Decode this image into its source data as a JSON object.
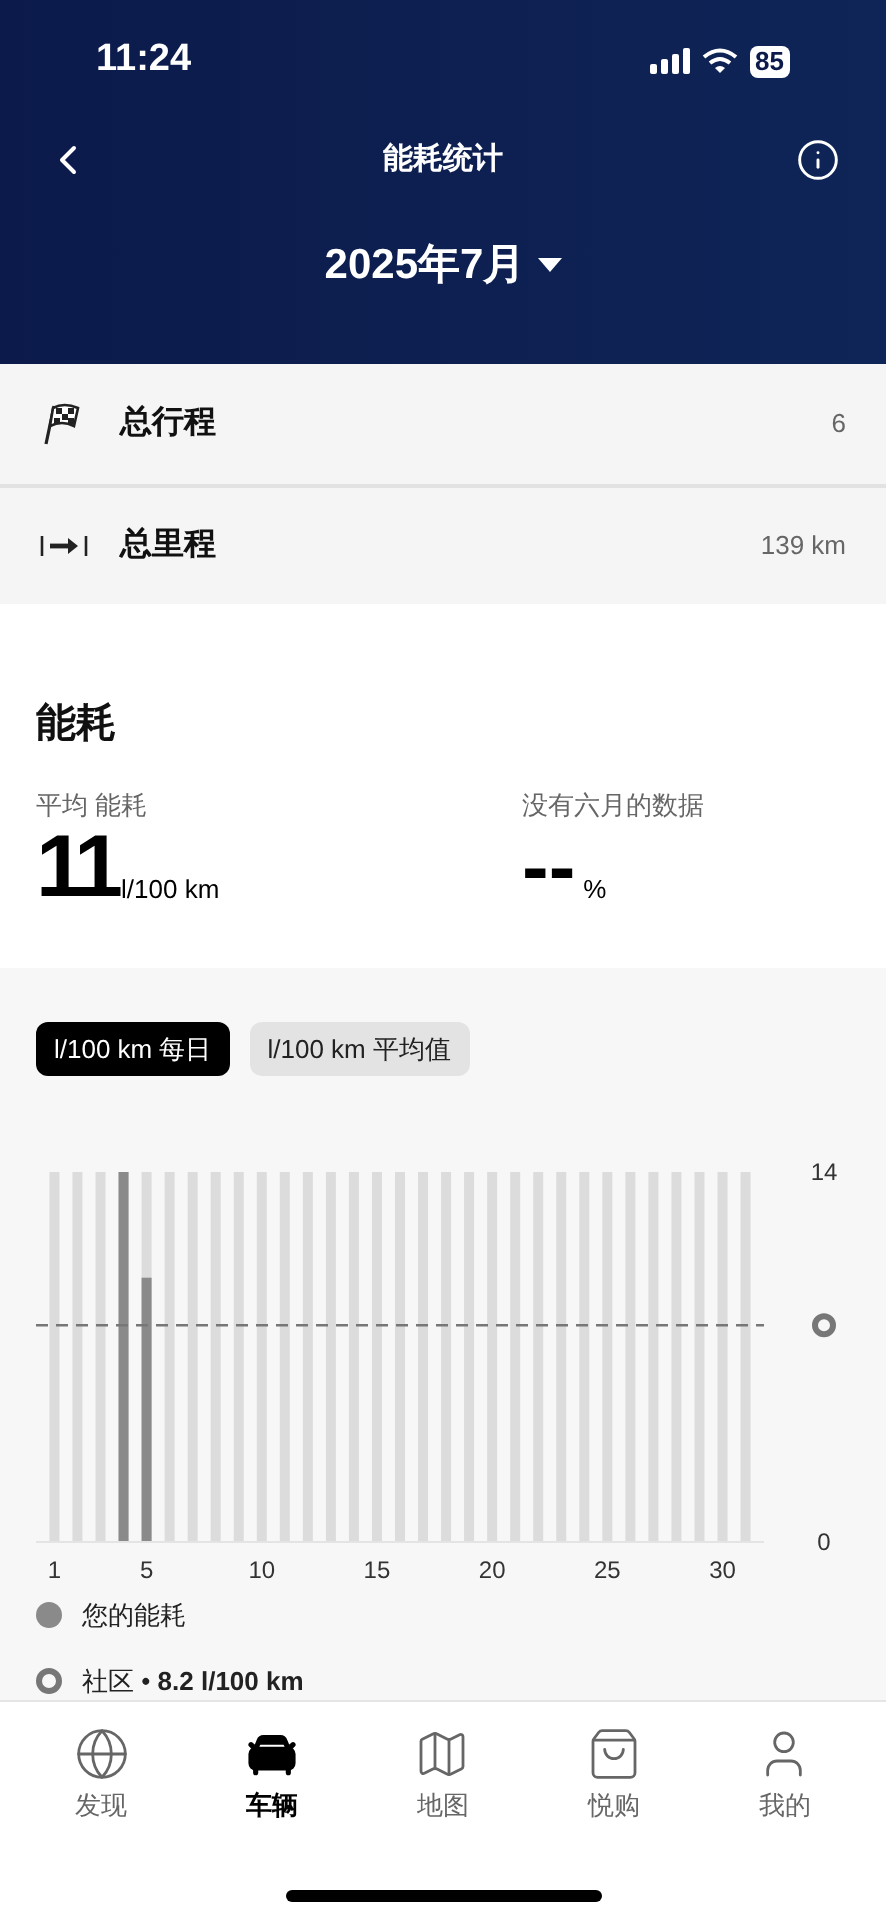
{
  "status_bar": {
    "time": "11:24",
    "battery": "85"
  },
  "header": {
    "title": "能耗统计",
    "period": "2025年7月"
  },
  "summary": [
    {
      "kind": "trips",
      "label": "总行程",
      "value": "6"
    },
    {
      "kind": "distance",
      "label": "总里程",
      "value": "139 km"
    }
  ],
  "consumption": {
    "title": "能耗",
    "average_label": "平均 能耗",
    "average_value": "11",
    "average_unit": "l/100 km",
    "compare_label": "没有六月的数据",
    "compare_value": "--",
    "compare_unit": "%"
  },
  "chart_tabs": [
    {
      "label": "l/100 km 每日",
      "selected": true
    },
    {
      "label": "l/100 km 平均值",
      "selected": false
    }
  ],
  "chart_data": {
    "type": "bar",
    "x": [
      4,
      5
    ],
    "series": [
      {
        "name": "您的能耗",
        "color": "#8a8a8a",
        "values": [
          14,
          10
        ]
      }
    ],
    "ylim": [
      0,
      14
    ],
    "yticks": [
      0,
      14
    ],
    "xticks": [
      1,
      5,
      10,
      15,
      20,
      25,
      30
    ],
    "xlim": [
      0.2,
      31.8
    ],
    "grid": true,
    "ref_lines": [
      {
        "axis": "y",
        "value": 8.2
      }
    ]
  },
  "legend": [
    {
      "kind": "ring",
      "label": "社区 • **8.2 l/100 km**"
    }
  ],
  "tab_bar": [
    {
      "kind": "globe",
      "label": "发现",
      "selected": false
    },
    {
      "kind": "car",
      "label": "车辆",
      "selected": true
    },
    {
      "kind": "map",
      "label": "地图",
      "selected": false
    },
    {
      "kind": "shop",
      "label": "悦购",
      "selected": false
    },
    {
      "kind": "user",
      "label": "我的",
      "selected": false
    }
  ]
}
